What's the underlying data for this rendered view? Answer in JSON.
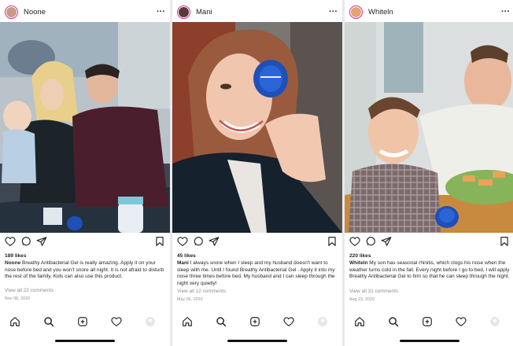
{
  "posts": [
    {
      "username": "Noone",
      "more": "···",
      "likes": "189 likes",
      "caption_user": "Noone",
      "caption_text": "Breathy Antibacterial Gel is really amazing. Apply it on your nose before bed and you won't snore all night. It is not afraid to disturb the rest of the family. Kids can also use this product.",
      "comments": "View all 22 comments",
      "date": "Nov 08, 2020"
    },
    {
      "username": "Mani",
      "more": "···",
      "likes": "45 likes",
      "caption_user": "Mani",
      "caption_text": "I always snore when I sleep and my husband doesn't want to sleep with me. Until I found Breathy Antibacterial Gel . Apply it into my nose three times before bed. My husband and I can sleep through the night very quietly!",
      "comments": "View all 12 comments",
      "date": "May 06, 2020"
    },
    {
      "username": "Whiteln",
      "more": "···",
      "likes": "220 likes",
      "caption_user": "Whiteln",
      "caption_text": "My son has seasonal rhinitis, which clogs his nose when the weather turns cold in the fall. Every night before I go to bed, I will apply Breathy Antibacterial Gel to him so that he can sleep through the night.",
      "comments": "View all 31 comments",
      "date": "Aug 23, 2020"
    }
  ],
  "icons": {
    "like": "heart-icon",
    "comment": "comment-icon",
    "share": "send-icon",
    "save": "bookmark-icon",
    "home": "home-icon",
    "search": "search-icon",
    "new_post": "add-post-icon",
    "activity": "heart-icon",
    "profile": "profile-avatar"
  },
  "colors": {
    "text": "#262626",
    "muted": "#8e8e8e",
    "story_ring": "#d6249f",
    "product_blue": "#1f4fb8"
  }
}
